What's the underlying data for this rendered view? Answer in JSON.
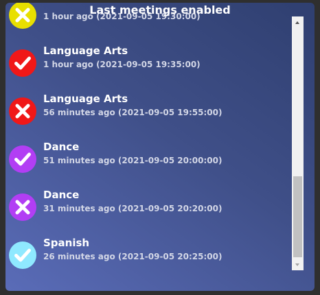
{
  "header": {
    "title": "Last meetings enabled"
  },
  "items": [
    {
      "title": "",
      "time": "1 hour ago (2021-09-05 19:30:00)",
      "status": "cancelled",
      "icon": "x-icon",
      "color": "#e8df00"
    },
    {
      "title": "Language Arts",
      "time": "1 hour ago (2021-09-05 19:35:00)",
      "status": "confirmed",
      "icon": "check-icon",
      "color": "#f01818"
    },
    {
      "title": "Language Arts",
      "time": "56 minutes ago (2021-09-05 19:55:00)",
      "status": "cancelled",
      "icon": "x-icon",
      "color": "#f01818"
    },
    {
      "title": "Dance",
      "time": "51 minutes ago (2021-09-05 20:00:00)",
      "status": "confirmed",
      "icon": "check-icon",
      "color": "#b23ef4"
    },
    {
      "title": "Dance",
      "time": "31 minutes ago (2021-09-05 20:20:00)",
      "status": "cancelled",
      "icon": "x-icon",
      "color": "#b23ef4"
    },
    {
      "title": "Spanish",
      "time": "26 minutes ago (2021-09-05 20:25:00)",
      "status": "confirmed",
      "icon": "check-icon",
      "color": "#8fe9ff"
    }
  ],
  "scrollbar": {
    "position": 0.8
  }
}
